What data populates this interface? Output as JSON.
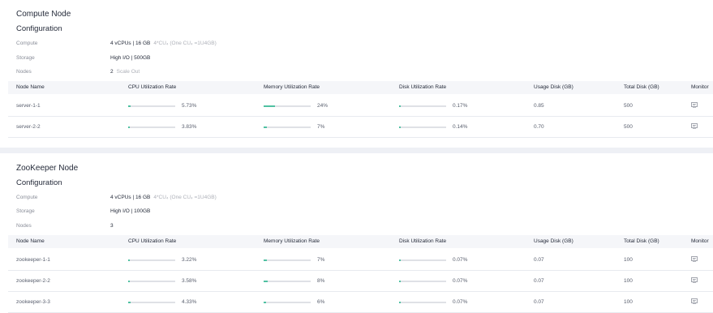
{
  "sections": [
    {
      "title": "Compute Node",
      "subtitle": "Configuration",
      "config": [
        {
          "label": "Compute",
          "value": "4 vCPUs | 16 GB",
          "extra": "4*CU₄ (One CU₄ =1U4GB)"
        },
        {
          "label": "Storage",
          "value": "High I/O | 500GB",
          "extra": ""
        },
        {
          "label": "Nodes",
          "value": "2",
          "extra": "Scale Out"
        }
      ],
      "headers": [
        "Node Name",
        "CPU Utilization Rate",
        "Memory Utilization Rate",
        "Disk Utilization Rate",
        "Usage Disk (GB)",
        "Total Disk (GB)",
        "Monitor"
      ],
      "rows": [
        {
          "name": "server-1-1",
          "cpu": "5.73%",
          "cpu_v": 0.0573,
          "mem": "24%",
          "mem_v": 0.24,
          "disk": "0.17%",
          "disk_v": 0.0017,
          "usage": "0.85",
          "total": "500"
        },
        {
          "name": "server-2-2",
          "cpu": "3.83%",
          "cpu_v": 0.0383,
          "mem": "7%",
          "mem_v": 0.07,
          "disk": "0.14%",
          "disk_v": 0.0014,
          "usage": "0.70",
          "total": "500"
        }
      ]
    },
    {
      "title": "ZooKeeper Node",
      "subtitle": "Configuration",
      "config": [
        {
          "label": "Compute",
          "value": "4 vCPUs | 16 GB",
          "extra": "4*CU₄ (One CU₄ =1U4GB)"
        },
        {
          "label": "Storage",
          "value": "High I/O | 100GB",
          "extra": ""
        },
        {
          "label": "Nodes",
          "value": "3",
          "extra": ""
        }
      ],
      "headers": [
        "Node Name",
        "CPU Utilization Rate",
        "Memory Utilization Rate",
        "Disk Utilization Rate",
        "Usage Disk (GB)",
        "Total Disk (GB)",
        "Monitor"
      ],
      "rows": [
        {
          "name": "zookeeper-1-1",
          "cpu": "3.22%",
          "cpu_v": 0.0322,
          "mem": "7%",
          "mem_v": 0.07,
          "disk": "0.07%",
          "disk_v": 0.0007,
          "usage": "0.07",
          "total": "100"
        },
        {
          "name": "zookeeper-2-2",
          "cpu": "3.58%",
          "cpu_v": 0.0358,
          "mem": "8%",
          "mem_v": 0.08,
          "disk": "0.07%",
          "disk_v": 0.0007,
          "usage": "0.07",
          "total": "100"
        },
        {
          "name": "zookeeper-3-3",
          "cpu": "4.33%",
          "cpu_v": 0.0433,
          "mem": "6%",
          "mem_v": 0.06,
          "disk": "0.07%",
          "disk_v": 0.0007,
          "usage": "0.07",
          "total": "100"
        }
      ]
    }
  ],
  "icons": {
    "monitor": "monitor-icon"
  },
  "colors": {
    "bar_fill": "#50c1a2",
    "bar_track": "#dfe1e6"
  }
}
